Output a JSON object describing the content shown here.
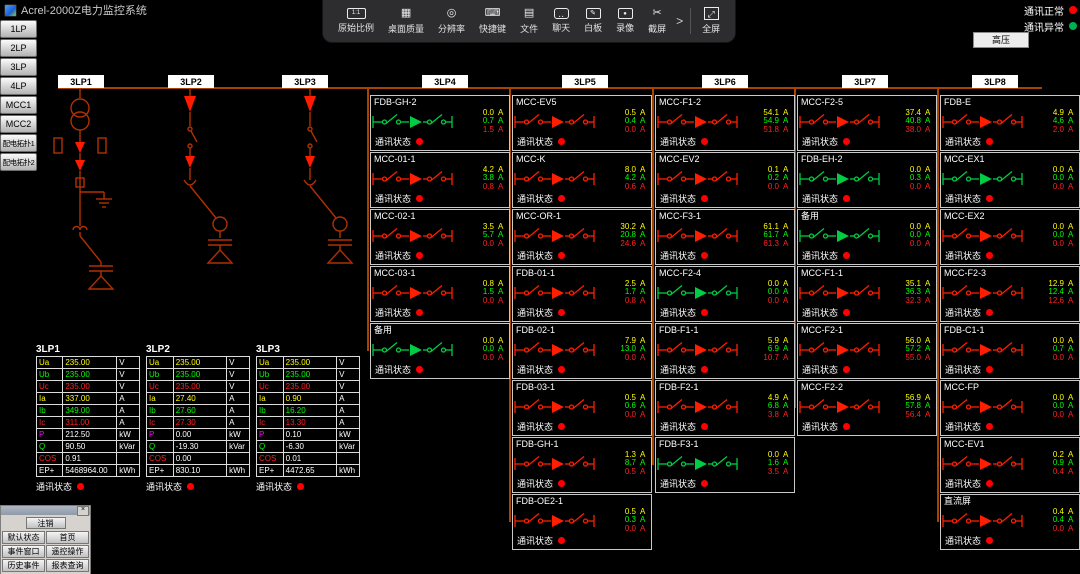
{
  "window": {
    "title": "Acrel-2000Z电力监控系统"
  },
  "toolbar": {
    "items": [
      {
        "id": "original-ratio",
        "label": "原始比例",
        "glyph": "1:1"
      },
      {
        "id": "desktop-quality",
        "label": "桌面质量",
        "glyph": "▦"
      },
      {
        "id": "resolution",
        "label": "分辨率",
        "glyph": "◎"
      },
      {
        "id": "hotkeys",
        "label": "快捷键",
        "glyph": "⌨"
      },
      {
        "id": "files",
        "label": "文件",
        "glyph": "▤"
      },
      {
        "id": "chat",
        "label": "聊天",
        "glyph": "‥"
      },
      {
        "id": "whiteboard",
        "label": "白板",
        "glyph": "✎"
      },
      {
        "id": "record",
        "label": "录像",
        "glyph": "●"
      },
      {
        "id": "screenshot",
        "label": "截屏",
        "glyph": "✂"
      }
    ],
    "more_glyph": ">",
    "fullscreen": {
      "id": "fullscreen",
      "label": "全屏",
      "glyph": "⤢"
    }
  },
  "legend": {
    "hv_label": "高压",
    "normal_label": "通讯正常",
    "normal_color": "#ff0000",
    "abnormal_label": "通讯异常",
    "abnormal_color": "#00b050"
  },
  "sidebar": {
    "items": [
      {
        "id": "1lp",
        "label": "1LP"
      },
      {
        "id": "2lp",
        "label": "2LP"
      },
      {
        "id": "3lp",
        "label": "3LP"
      },
      {
        "id": "4lp",
        "label": "4LP"
      },
      {
        "id": "mcc1",
        "label": "MCC1"
      },
      {
        "id": "mcc2",
        "label": "MCC2"
      },
      {
        "id": "topo1",
        "label": "配电拓扑1"
      },
      {
        "id": "topo2",
        "label": "配电拓扑2"
      }
    ]
  },
  "bus_labels": [
    "3LP1",
    "3LP2",
    "3LP3",
    "3LP4",
    "3LP5",
    "3LP6",
    "3LP7",
    "3LP8"
  ],
  "tables": {
    "comm_label": "通讯状态",
    "row_names": [
      "Ua",
      "Ub",
      "Uc",
      "Ia",
      "Ib",
      "Ic",
      "P",
      "Q",
      "COS",
      "EP+"
    ],
    "row_units": [
      "V",
      "V",
      "V",
      "A",
      "A",
      "A",
      "kW",
      "kVar",
      "",
      "kWh"
    ],
    "row_colors": [
      "#ffff00",
      "#00ff00",
      "#ff2020",
      "#ffff00",
      "#00ff00",
      "#ff2020",
      "#ff00ff",
      "#00ff00",
      "#ff2020",
      "#ffffff"
    ],
    "value_colors": [
      "#ffff00",
      "#00ff00",
      "#ff2020",
      "#ffff00",
      "#00ff00",
      "#ff2020",
      "#ffffff",
      "#ffffff",
      "#ffffff",
      "#ffffff"
    ],
    "items": [
      {
        "title": "3LP1",
        "values": [
          "235.00",
          "235.00",
          "235.00",
          "337.00",
          "349.00",
          "311.00",
          "212.50",
          "90.50",
          "0.91",
          "5468964.00"
        ]
      },
      {
        "title": "3LP2",
        "values": [
          "235.00",
          "235.00",
          "235.00",
          "27.40",
          "27.60",
          "27.30",
          "0.00",
          "-19.30",
          "0.00",
          "830.10"
        ]
      },
      {
        "title": "3LP3",
        "values": [
          "235.00",
          "235.00",
          "235.00",
          "0.90",
          "16.20",
          "13.30",
          "0.10",
          "-6.30",
          "0.01",
          "4472.65"
        ]
      }
    ]
  },
  "feeders": {
    "comm_label": "通讯状态",
    "unit": "A",
    "columns": [
      {
        "bus": "3LP4",
        "panels": [
          {
            "t": "FDB-GH-2",
            "s": "open",
            "v": [
              "0.0",
              "0.7",
              "1.5"
            ]
          },
          {
            "t": "MCC-01-1",
            "s": "closed",
            "v": [
              "4.2",
              "3.8",
              "0.8"
            ]
          },
          {
            "t": "MCC-02-1",
            "s": "closed",
            "v": [
              "3.5",
              "5.7",
              "0.0"
            ]
          },
          {
            "t": "MCC-03-1",
            "s": "closed",
            "v": [
              "0.8",
              "1.5",
              "0.0"
            ]
          },
          {
            "t": "备用",
            "s": "open",
            "v": [
              "0.0",
              "0.0",
              "0.0"
            ]
          }
        ]
      },
      {
        "bus": "3LP5",
        "panels": [
          {
            "t": "MCC-EV5",
            "s": "closed",
            "v": [
              "0.5",
              "0.4",
              "0.0"
            ]
          },
          {
            "t": "MCC-K",
            "s": "closed",
            "v": [
              "8.0",
              "4.2",
              "0.6"
            ]
          },
          {
            "t": "MCC-OR-1",
            "s": "closed",
            "v": [
              "30.2",
              "20.8",
              "24.6"
            ]
          },
          {
            "t": "FDB-01-1",
            "s": "closed",
            "v": [
              "2.5",
              "1.7",
              "0.8"
            ]
          },
          {
            "t": "FDB-02-1",
            "s": "closed",
            "v": [
              "7.9",
              "13.0",
              "0.0"
            ]
          },
          {
            "t": "FDB-03-1",
            "s": "closed",
            "v": [
              "0.5",
              "0.6",
              "0.0"
            ]
          },
          {
            "t": "FDB-GH-1",
            "s": "closed",
            "v": [
              "1.3",
              "8.7",
              "0.5"
            ]
          },
          {
            "t": "FDB-OE2-1",
            "s": "closed",
            "v": [
              "0.5",
              "0.3",
              "0.0"
            ]
          }
        ]
      },
      {
        "bus": "3LP6",
        "panels": [
          {
            "t": "MCC-F1-2",
            "s": "closed",
            "v": [
              "54.1",
              "54.9",
              "51.8"
            ]
          },
          {
            "t": "MCC-EV2",
            "s": "closed",
            "v": [
              "0.1",
              "0.2",
              "0.0"
            ]
          },
          {
            "t": "MCC-F3-1",
            "s": "closed",
            "v": [
              "61.1",
              "61.7",
              "61.3"
            ]
          },
          {
            "t": "MCC-F2-4",
            "s": "open",
            "v": [
              "0.0",
              "0.0",
              "0.0"
            ]
          },
          {
            "t": "FDB-F1-1",
            "s": "closed",
            "v": [
              "5.9",
              "6.9",
              "10.7"
            ]
          },
          {
            "t": "FDB-F2-1",
            "s": "closed",
            "v": [
              "4.9",
              "6.8",
              "3.8"
            ]
          },
          {
            "t": "FDB-F3-1",
            "s": "open",
            "v": [
              "0.0",
              "1.6",
              "3.5"
            ]
          }
        ]
      },
      {
        "bus": "3LP7",
        "panels": [
          {
            "t": "MCC-F2-5",
            "s": "closed",
            "v": [
              "37.4",
              "40.8",
              "38.0"
            ]
          },
          {
            "t": "FDB-EH-2",
            "s": "open",
            "v": [
              "0.0",
              "0.3",
              "0.0"
            ]
          },
          {
            "t": "备用",
            "s": "open",
            "v": [
              "0.0",
              "0.0",
              "0.0"
            ]
          },
          {
            "t": "MCC-F1-1",
            "s": "closed",
            "v": [
              "35.1",
              "36.3",
              "32.3"
            ]
          },
          {
            "t": "MCC-F2-1",
            "s": "closed",
            "v": [
              "56.0",
              "57.2",
              "55.0"
            ]
          },
          {
            "t": "MCC-F2-2",
            "s": "closed",
            "v": [
              "56.9",
              "57.8",
              "56.4"
            ]
          }
        ]
      },
      {
        "bus": "3LP8",
        "panels": [
          {
            "t": "FDB-E",
            "s": "closed",
            "v": [
              "4.9",
              "4.6",
              "2.0"
            ]
          },
          {
            "t": "MCC-EX1",
            "s": "open",
            "v": [
              "0.0",
              "0.0",
              "0.0"
            ]
          },
          {
            "t": "MCC-EX2",
            "s": "closed",
            "v": [
              "0.0",
              "0.0",
              "0.0"
            ]
          },
          {
            "t": "MCC-F2-3",
            "s": "closed",
            "v": [
              "12.9",
              "12.4",
              "12.6"
            ]
          },
          {
            "t": "FDB-C1-1",
            "s": "closed",
            "v": [
              "0.0",
              "0.7",
              "0.0"
            ]
          },
          {
            "t": "MCC-FP",
            "s": "closed",
            "v": [
              "0.0",
              "0.0",
              "0.0"
            ]
          },
          {
            "t": "MCC-EV1",
            "s": "closed",
            "v": [
              "0.2",
              "0.9",
              "0.4"
            ]
          },
          {
            "t": "直流屏",
            "s": "closed",
            "v": [
              "0.4",
              "0.4",
              "0.0"
            ]
          }
        ]
      }
    ]
  },
  "popup": {
    "close_glyph": "×",
    "logout_label": "注销",
    "buttons": [
      {
        "id": "default-state",
        "label": "默认状态"
      },
      {
        "id": "home",
        "label": "首页"
      },
      {
        "id": "event-window",
        "label": "事件窗口"
      },
      {
        "id": "remote-control",
        "label": "遥控操作"
      },
      {
        "id": "history-events",
        "label": "历史事件"
      },
      {
        "id": "report-query",
        "label": "报表查询"
      }
    ]
  },
  "colors": {
    "closed": "#ff1e00",
    "open": "#00cc44",
    "phase": [
      "#ffff00",
      "#00ff00",
      "#ff2020"
    ],
    "dot": "#ff0000",
    "line": "#a84300"
  }
}
